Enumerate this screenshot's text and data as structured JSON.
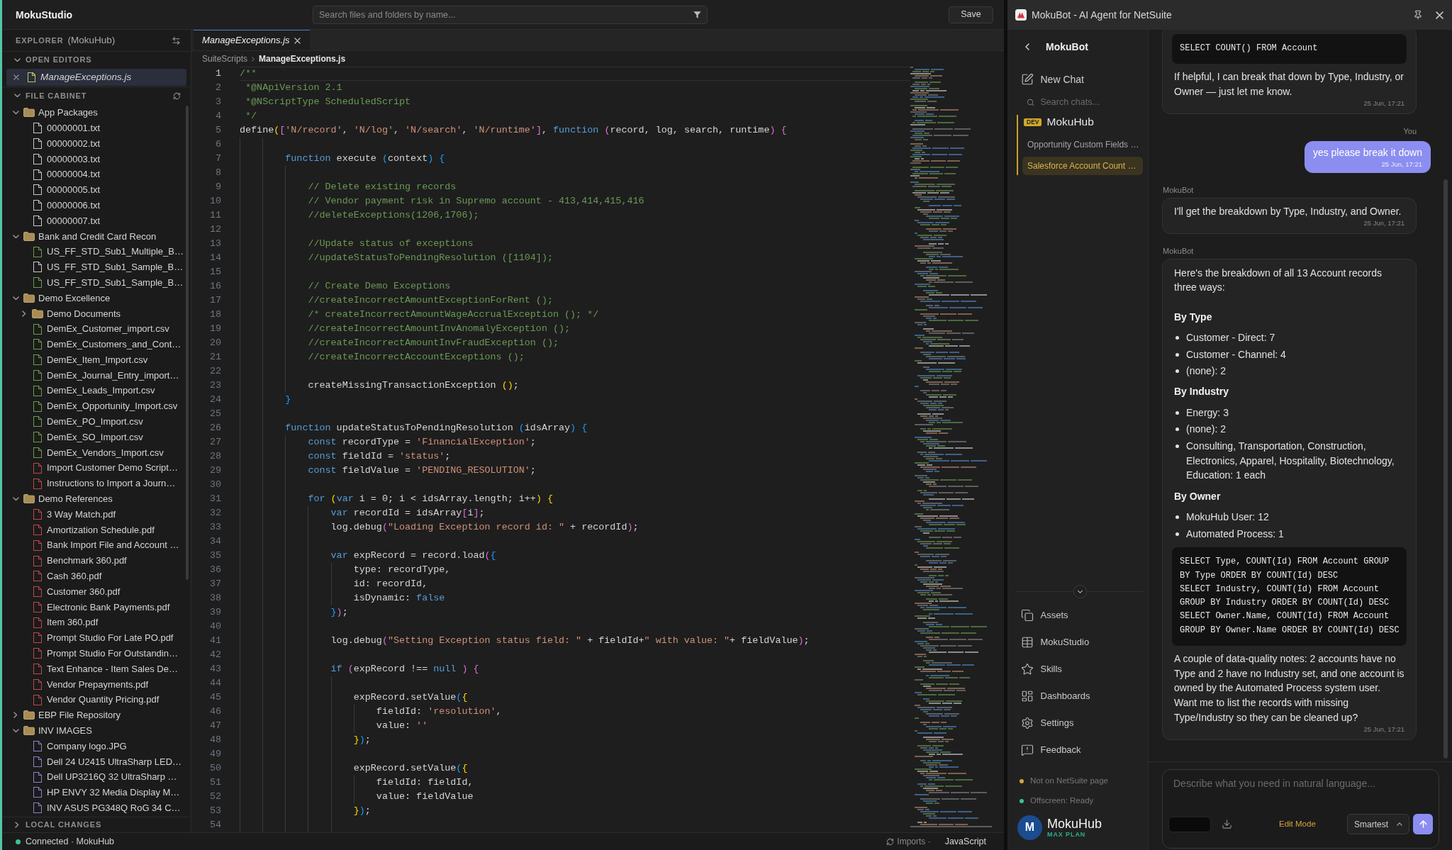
{
  "ide": {
    "title": "MokuStudio",
    "search": {
      "placeholder": "Search files and folders by name..."
    },
    "save_button": "Save",
    "explorer": {
      "title": "EXPLORER",
      "workspace": "(MokuHub)",
      "open_editors": {
        "title": "OPEN EDITORS",
        "expanded": true,
        "items": [
          {
            "name": "ManageExceptions.js",
            "selected": true
          }
        ]
      },
      "file_cabinet": {
        "title": "FILE CABINET",
        "expanded": true,
        "tree": [
          {
            "kind": "folder",
            "name": "App Packages",
            "expanded": true,
            "children": [
              {
                "kind": "file",
                "name": "00000001.txt",
                "color": "#c8c8c8"
              },
              {
                "kind": "file",
                "name": "00000002.txt",
                "color": "#c8c8c8"
              },
              {
                "kind": "file",
                "name": "00000003.txt",
                "color": "#c8c8c8"
              },
              {
                "kind": "file",
                "name": "00000004.txt",
                "color": "#c8c8c8"
              },
              {
                "kind": "file",
                "name": "00000005.txt",
                "color": "#c8c8c8"
              },
              {
                "kind": "file",
                "name": "00000006.txt",
                "color": "#c8c8c8"
              },
              {
                "kind": "file",
                "name": "00000007.txt",
                "color": "#c8c8c8"
              }
            ]
          },
          {
            "kind": "folder",
            "name": "Bank and Credit Card Recon",
            "expanded": true,
            "children": [
              {
                "kind": "file",
                "name": "US_FF_STD_Sub1_Multiple_B…",
                "color": "#6f9a4c"
              },
              {
                "kind": "file",
                "name": "US_FF_STD_Sub1_Sample_B…",
                "color": "#c8c8c8"
              },
              {
                "kind": "file",
                "name": "US_FF_STD_Sub1_Sample_B…",
                "color": "#6f9a4c"
              }
            ]
          },
          {
            "kind": "folder",
            "name": "Demo Excellence",
            "expanded": true,
            "children": [
              {
                "kind": "folder",
                "name": "Demo Documents",
                "expanded": false
              },
              {
                "kind": "file",
                "name": "DemEx_Customer_import.csv",
                "color": "#6f9a4c"
              },
              {
                "kind": "file",
                "name": "DemEx_Customers_and_Cont…",
                "color": "#6f9a4c"
              },
              {
                "kind": "file",
                "name": "DemEx_Item_Import.csv",
                "color": "#6f9a4c"
              },
              {
                "kind": "file",
                "name": "DemEx_Journal_Entry_import…",
                "color": "#6f9a4c"
              },
              {
                "kind": "file",
                "name": "DemEx_Leads_Import.csv",
                "color": "#6f9a4c"
              },
              {
                "kind": "file",
                "name": "DemEx_Opportunity_Import.csv",
                "color": "#6f9a4c"
              },
              {
                "kind": "file",
                "name": "DemEx_PO_Import.csv",
                "color": "#6f9a4c"
              },
              {
                "kind": "file",
                "name": "DemEx_SO_Import.csv",
                "color": "#6f9a4c"
              },
              {
                "kind": "file",
                "name": "DemEx_Vendors_Import.csv",
                "color": "#6f9a4c"
              },
              {
                "kind": "file",
                "name": "Import Customer Demo Script…",
                "color": "#c0454d"
              },
              {
                "kind": "file",
                "name": "Instructions to Import a Journ…",
                "color": "#c0454d"
              }
            ]
          },
          {
            "kind": "folder",
            "name": "Demo References",
            "expanded": true,
            "children": [
              {
                "kind": "file",
                "name": "3 Way Match.pdf",
                "color": "#c0454d"
              },
              {
                "kind": "file",
                "name": "Amortization Schedule.pdf",
                "color": "#c0454d"
              },
              {
                "kind": "file",
                "name": "Bank Import File and Account …",
                "color": "#c0454d"
              },
              {
                "kind": "file",
                "name": "Benchmark 360.pdf",
                "color": "#c0454d"
              },
              {
                "kind": "file",
                "name": "Cash 360.pdf",
                "color": "#c0454d"
              },
              {
                "kind": "file",
                "name": "Customer 360.pdf",
                "color": "#c0454d"
              },
              {
                "kind": "file",
                "name": "Electronic Bank Payments.pdf",
                "color": "#c0454d"
              },
              {
                "kind": "file",
                "name": "Item 360.pdf",
                "color": "#c0454d"
              },
              {
                "kind": "file",
                "name": "Prompt Studio For Late PO.pdf",
                "color": "#c0454d"
              },
              {
                "kind": "file",
                "name": "Prompt Studio For Outstandin…",
                "color": "#c0454d"
              },
              {
                "kind": "file",
                "name": "Text Enhance - Item Sales De…",
                "color": "#c0454d"
              },
              {
                "kind": "file",
                "name": "Vendor Prepayments.pdf",
                "color": "#c0454d"
              },
              {
                "kind": "file",
                "name": "Vendor Quantity Pricing.pdf",
                "color": "#c0454d"
              }
            ]
          },
          {
            "kind": "folder",
            "name": "EBP File Repository",
            "expanded": false
          },
          {
            "kind": "folder",
            "name": "INV IMAGES",
            "expanded": true,
            "children": [
              {
                "kind": "file",
                "name": "Company logo.JPG",
                "color": "#8d7fc4"
              },
              {
                "kind": "file",
                "name": "Dell 24 U2415 UltraSharp LED…",
                "color": "#8d7fc4"
              },
              {
                "kind": "file",
                "name": "Dell UP3216Q 32 UltraSharp …",
                "color": "#8d7fc4"
              },
              {
                "kind": "file",
                "name": "HP ENVY 32 Media Display M…",
                "color": "#8d7fc4"
              },
              {
                "kind": "file",
                "name": "INV ASUS PG348Q RoG 34 C…",
                "color": "#8d7fc4"
              }
            ]
          }
        ]
      },
      "local_changes": {
        "title": "LOCAL CHANGES",
        "expanded": false
      }
    },
    "tabs": [
      {
        "label": "ManageExceptions.js",
        "selected": true
      }
    ],
    "breadcrumb": [
      "SuiteScripts",
      "ManageExceptions.js"
    ],
    "code": {
      "lines": [
        {
          "number": "1",
          "current": true,
          "tokens": [
            {
              "kind": "comment",
              "text": "/**"
            }
          ]
        },
        {
          "number": "2",
          "current": false,
          "tokens": [
            {
              "kind": "comment",
              "text": " *@NApiVersion 2.1"
            }
          ]
        },
        {
          "number": "3",
          "current": false,
          "tokens": [
            {
              "kind": "comment",
              "text": " *@NScriptType ScheduledScript"
            }
          ]
        },
        {
          "number": "4",
          "current": false,
          "tokens": [
            {
              "kind": "comment",
              "text": " */"
            }
          ]
        },
        {
          "number": "5",
          "current": false,
          "tokens": [
            {
              "kind": "plain",
              "text": "define"
            },
            {
              "kind": "bracket1",
              "text": "("
            },
            {
              "kind": "bracket2",
              "text": "["
            },
            {
              "kind": "string",
              "text": "'N/record'"
            },
            {
              "kind": "plain",
              "text": ", "
            },
            {
              "kind": "string",
              "text": "'N/log'"
            },
            {
              "kind": "plain",
              "text": ", "
            },
            {
              "kind": "string",
              "text": "'N/search'"
            },
            {
              "kind": "plain",
              "text": ", "
            },
            {
              "kind": "string",
              "text": "'N/runtime'"
            },
            {
              "kind": "bracket2",
              "text": "]"
            },
            {
              "kind": "plain",
              "text": ", "
            },
            {
              "kind": "keyword",
              "text": "function "
            },
            {
              "kind": "bracket2",
              "text": "("
            },
            {
              "kind": "plain",
              "text": "record, log, search, runtime"
            },
            {
              "kind": "bracket2",
              "text": ") "
            },
            {
              "kind": "bracket2",
              "text": "{"
            }
          ]
        },
        {
          "number": "6",
          "current": false
        },
        {
          "number": "7",
          "current": false,
          "tokens": [
            {
              "kind": "keyword",
              "text": "        function"
            },
            {
              "kind": "plain",
              "text": " execute "
            },
            {
              "kind": "bracket3",
              "text": "("
            },
            {
              "kind": "plain",
              "text": "context"
            },
            {
              "kind": "bracket3",
              "text": ") "
            },
            {
              "kind": "bracket3",
              "text": "{"
            }
          ]
        },
        {
          "number": "8",
          "current": false
        },
        {
          "number": "9",
          "current": false,
          "tokens": [
            {
              "kind": "comment",
              "text": "            // Delete existing records"
            }
          ]
        },
        {
          "number": "10",
          "current": false,
          "tokens": [
            {
              "kind": "comment",
              "text": "            // Vendor payment risk in Supremo account - 413,414,415,416"
            }
          ]
        },
        {
          "number": "11",
          "current": false,
          "tokens": [
            {
              "kind": "comment",
              "text": "            //deleteExceptions(1206,1706);"
            }
          ]
        },
        {
          "number": "12",
          "current": false
        },
        {
          "number": "13",
          "current": false,
          "tokens": [
            {
              "kind": "comment",
              "text": "            //Update status of exceptions"
            }
          ]
        },
        {
          "number": "14",
          "current": false,
          "tokens": [
            {
              "kind": "comment",
              "text": "            //updateStatusToPendingResolution ([1104]);"
            }
          ]
        },
        {
          "number": "15",
          "current": false
        },
        {
          "number": "16",
          "current": false,
          "tokens": [
            {
              "kind": "comment",
              "text": "            // Create Demo Exceptions"
            }
          ]
        },
        {
          "number": "17",
          "current": false,
          "tokens": [
            {
              "kind": "comment",
              "text": "            //createIncorrectAmountExceptionForRent ();"
            }
          ]
        },
        {
          "number": "18",
          "current": false,
          "tokens": [
            {
              "kind": "comment",
              "text": "            /* createIncorrectAmountWageAccrualException (); */"
            }
          ]
        },
        {
          "number": "19",
          "current": false,
          "tokens": [
            {
              "kind": "comment",
              "text": "            //createIncorrectAmountInvAnomalyException ();"
            }
          ]
        },
        {
          "number": "20",
          "current": false,
          "tokens": [
            {
              "kind": "comment",
              "text": "            //createIncorrectAmountInvFraudException ();"
            }
          ]
        },
        {
          "number": "21",
          "current": false,
          "tokens": [
            {
              "kind": "comment",
              "text": "            //createIncorrectAccountExceptions ();"
            }
          ]
        },
        {
          "number": "22",
          "current": false
        },
        {
          "number": "23",
          "current": false,
          "tokens": [
            {
              "kind": "plain",
              "text": "            createMissingTransactionException "
            },
            {
              "kind": "bracket1",
              "text": "()"
            },
            {
              "kind": "plain",
              "text": ";"
            }
          ]
        },
        {
          "number": "24",
          "current": false,
          "tokens": [
            {
              "kind": "bracket3",
              "text": "        }"
            }
          ]
        },
        {
          "number": "25",
          "current": false
        },
        {
          "number": "26",
          "current": false,
          "tokens": [
            {
              "kind": "keyword",
              "text": "        function"
            },
            {
              "kind": "plain",
              "text": " updateStatusToPendingResolution "
            },
            {
              "kind": "bracket3",
              "text": "("
            },
            {
              "kind": "plain",
              "text": "idsArray"
            },
            {
              "kind": "bracket3",
              "text": ") "
            },
            {
              "kind": "bracket3",
              "text": "{"
            }
          ]
        },
        {
          "number": "27",
          "current": false,
          "tokens": [
            {
              "kind": "keyword",
              "text": "            const"
            },
            {
              "kind": "plain",
              "text": " recordType = "
            },
            {
              "kind": "string",
              "text": "'FinancialException'"
            },
            {
              "kind": "plain",
              "text": ";"
            }
          ]
        },
        {
          "number": "28",
          "current": false,
          "tokens": [
            {
              "kind": "keyword",
              "text": "            const"
            },
            {
              "kind": "plain",
              "text": " fieldId = "
            },
            {
              "kind": "string",
              "text": "'status'"
            },
            {
              "kind": "plain",
              "text": ";"
            }
          ]
        },
        {
          "number": "29",
          "current": false,
          "tokens": [
            {
              "kind": "keyword",
              "text": "            const"
            },
            {
              "kind": "plain",
              "text": " fieldValue = "
            },
            {
              "kind": "string",
              "text": "'PENDING_RESOLUTION'"
            },
            {
              "kind": "plain",
              "text": ";"
            }
          ]
        },
        {
          "number": "30",
          "current": false
        },
        {
          "number": "31",
          "current": false,
          "tokens": [
            {
              "kind": "keyword",
              "text": "            for "
            },
            {
              "kind": "bracket1",
              "text": "("
            },
            {
              "kind": "keyword",
              "text": "var"
            },
            {
              "kind": "plain",
              "text": " i = 0; i < idsArray.length; i++"
            },
            {
              "kind": "bracket1",
              "text": ") "
            },
            {
              "kind": "bracket1",
              "text": "{"
            }
          ]
        },
        {
          "number": "32",
          "current": false,
          "tokens": [
            {
              "kind": "keyword",
              "text": "                var"
            },
            {
              "kind": "plain",
              "text": " recordId = idsArray"
            },
            {
              "kind": "bracket2",
              "text": "["
            },
            {
              "kind": "plain",
              "text": "i"
            },
            {
              "kind": "bracket2",
              "text": "]"
            },
            {
              "kind": "plain",
              "text": ";"
            }
          ]
        },
        {
          "number": "33",
          "current": false,
          "tokens": [
            {
              "kind": "plain",
              "text": "                log.debug"
            },
            {
              "kind": "bracket2",
              "text": "("
            },
            {
              "kind": "string",
              "text": "\"Loading Exception record id: \""
            },
            {
              "kind": "plain",
              "text": " + recordId"
            },
            {
              "kind": "bracket2",
              "text": ")"
            },
            {
              "kind": "plain",
              "text": ";"
            }
          ]
        },
        {
          "number": "34",
          "current": false
        },
        {
          "number": "35",
          "current": false,
          "tokens": [
            {
              "kind": "keyword",
              "text": "                var"
            },
            {
              "kind": "plain",
              "text": " expRecord = record.load"
            },
            {
              "kind": "bracket2",
              "text": "("
            },
            {
              "kind": "bracket3",
              "text": "{"
            }
          ]
        },
        {
          "number": "36",
          "current": false,
          "tokens": [
            {
              "kind": "plain",
              "text": "                    type: recordType,"
            }
          ]
        },
        {
          "number": "37",
          "current": false,
          "tokens": [
            {
              "kind": "plain",
              "text": "                    id: recordId,"
            }
          ]
        },
        {
          "number": "38",
          "current": false,
          "tokens": [
            {
              "kind": "plain",
              "text": "                    isDynamic: "
            },
            {
              "kind": "keyword",
              "text": "false"
            }
          ]
        },
        {
          "number": "39",
          "current": false,
          "tokens": [
            {
              "kind": "bracket3",
              "text": "                }"
            },
            {
              "kind": "bracket2",
              "text": ")"
            },
            {
              "kind": "plain",
              "text": ";"
            }
          ]
        },
        {
          "number": "40",
          "current": false
        },
        {
          "number": "41",
          "current": false,
          "tokens": [
            {
              "kind": "plain",
              "text": "                log.debug"
            },
            {
              "kind": "bracket2",
              "text": "("
            },
            {
              "kind": "string",
              "text": "\"Setting Exception status field: \""
            },
            {
              "kind": "plain",
              "text": " + fieldId+"
            },
            {
              "kind": "string",
              "text": "\" with value: \""
            },
            {
              "kind": "plain",
              "text": "+ fieldValue"
            },
            {
              "kind": "bracket2",
              "text": ")"
            },
            {
              "kind": "plain",
              "text": ";"
            }
          ]
        },
        {
          "number": "42",
          "current": false
        },
        {
          "number": "43",
          "current": false,
          "tokens": [
            {
              "kind": "keyword",
              "text": "                if "
            },
            {
              "kind": "bracket2",
              "text": "("
            },
            {
              "kind": "plain",
              "text": "expRecord !== "
            },
            {
              "kind": "keyword",
              "text": "null "
            },
            {
              "kind": "bracket2",
              "text": ") "
            },
            {
              "kind": "bracket2",
              "text": "{"
            }
          ]
        },
        {
          "number": "44",
          "current": false
        },
        {
          "number": "45",
          "current": false,
          "tokens": [
            {
              "kind": "plain",
              "text": "                    expRecord.setValue"
            },
            {
              "kind": "bracket3",
              "text": "("
            },
            {
              "kind": "bracket1",
              "text": "{"
            }
          ]
        },
        {
          "number": "46",
          "current": false,
          "tokens": [
            {
              "kind": "plain",
              "text": "                        fieldId: "
            },
            {
              "kind": "string",
              "text": "'resolution'"
            },
            {
              "kind": "plain",
              "text": ","
            }
          ]
        },
        {
          "number": "47",
          "current": false,
          "tokens": [
            {
              "kind": "plain",
              "text": "                        value: "
            },
            {
              "kind": "string",
              "text": "''"
            }
          ]
        },
        {
          "number": "48",
          "current": false,
          "tokens": [
            {
              "kind": "bracket1",
              "text": "                    }"
            },
            {
              "kind": "bracket3",
              "text": ")"
            },
            {
              "kind": "plain",
              "text": ";"
            }
          ]
        },
        {
          "number": "49",
          "current": false
        },
        {
          "number": "50",
          "current": false,
          "tokens": [
            {
              "kind": "plain",
              "text": "                    expRecord.setValue"
            },
            {
              "kind": "bracket3",
              "text": "("
            },
            {
              "kind": "bracket1",
              "text": "{"
            }
          ]
        },
        {
          "number": "51",
          "current": false,
          "tokens": [
            {
              "kind": "plain",
              "text": "                        fieldId: fieldId,"
            }
          ]
        },
        {
          "number": "52",
          "current": false,
          "tokens": [
            {
              "kind": "plain",
              "text": "                        value: fieldValue"
            }
          ]
        },
        {
          "number": "53",
          "current": false,
          "tokens": [
            {
              "kind": "bracket1",
              "text": "                    }"
            },
            {
              "kind": "bracket3",
              "text": ")"
            },
            {
              "kind": "plain",
              "text": ";"
            }
          ]
        },
        {
          "number": "54",
          "current": false
        }
      ]
    },
    "status_bar": {
      "connected": true,
      "connection": "Connected · MokuHub",
      "imports": "Imports ·",
      "language": "JavaScript"
    }
  },
  "bot": {
    "title": "MokuBot - AI Agent for NetSuite",
    "nav": {
      "title": "MokuBot",
      "new_chat": "New Chat",
      "search": {
        "placeholder": "Search chats..."
      },
      "project": {
        "badge": "DEV",
        "name": "MokuHub",
        "chats": [
          {
            "title": "Opportunity Custom Fields …",
            "selected": false
          },
          {
            "title": "Salesforce Account Count …",
            "selected": true
          }
        ]
      },
      "menu": [
        "Assets",
        "MokuStudio",
        "Skills",
        "Dashboards",
        "Settings",
        "Feedback"
      ],
      "status": [
        {
          "label": "Not on NetSuite page",
          "color": "#d9a23c"
        },
        {
          "label": "Offscreen: Ready",
          "color": "#3dbf9f"
        }
      ],
      "account": {
        "initial": "M",
        "name": "MokuHub",
        "plan": "MAX PLAN"
      }
    },
    "chat": {
      "messages": [
        {
          "kind": "bot",
          "blocks": [
            {
              "kind": "code",
              "lines": [
                "SELECT COUNT() FROM Account"
              ]
            },
            {
              "kind": "paragraph",
              "text": "If helpful, I can break that down by Type, Industry, or Owner — just let me know."
            }
          ],
          "time": "25 Jun, 17:21"
        },
        {
          "kind": "user",
          "label": "You",
          "text": "yes please break it down",
          "time": "25 Jun, 17:21"
        },
        {
          "kind": "bot",
          "label": "MokuBot",
          "blocks": [
            {
              "kind": "paragraph",
              "text": "I'll get the breakdown by Type, Industry, and Owner."
            }
          ],
          "time": "25 Jun, 17:21"
        },
        {
          "kind": "bot",
          "label": "MokuBot",
          "blocks": [
            {
              "kind": "paragraph",
              "text": "Here's the breakdown of all 13 Account records three ways:"
            },
            {
              "kind": "heading",
              "text": "By Type"
            },
            {
              "kind": "list",
              "items": [
                "Customer - Direct: 7",
                "Customer - Channel: 4",
                "(none): 2"
              ]
            },
            {
              "kind": "heading",
              "text": "By Industry"
            },
            {
              "kind": "list",
              "items": [
                "Energy: 3",
                "(none): 2",
                "Consulting, Transportation, Construction, Electronics, Apparel, Hospitality, Biotechnology, Education: 1 each"
              ]
            },
            {
              "kind": "heading",
              "text": "By Owner"
            },
            {
              "kind": "list",
              "items": [
                "MokuHub User: 12",
                "Automated Process: 1"
              ]
            },
            {
              "kind": "code",
              "lines": [
                "SELECT Type, COUNT(Id) FROM Account GROUP",
                "BY Type ORDER BY COUNT(Id) DESC",
                "SELECT Industry, COUNT(Id) FROM Account",
                "GROUP BY Industry ORDER BY COUNT(Id) DESC",
                "SELECT Owner.Name, COUNT(Id) FROM Account",
                "GROUP BY Owner.Name ORDER BY COUNT(Id) DESC"
              ]
            },
            {
              "kind": "paragraph",
              "text": "A couple of data-quality notes: 2 accounts have no Type and 2 have no Industry set, and one account is owned by the Automated Process system user. Want me to list the records with missing Type/Industry so they can be cleaned up?"
            }
          ],
          "time": "25 Jun, 17:21"
        }
      ]
    },
    "composer": {
      "placeholder": "Describe what you need in natural language...",
      "mode": "Edit Mode",
      "model": "Smartest"
    }
  }
}
